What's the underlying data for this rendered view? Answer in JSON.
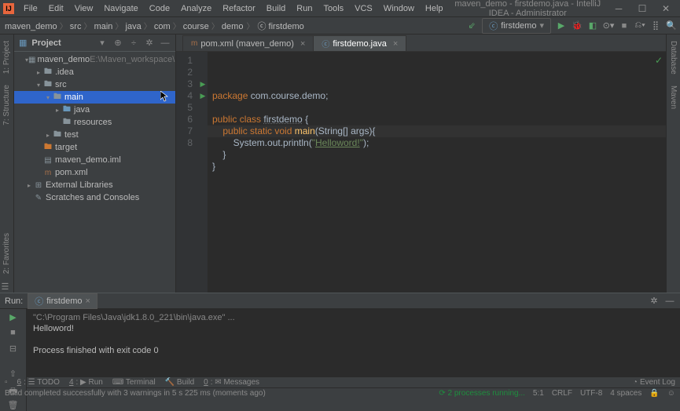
{
  "window": {
    "title": "maven_demo - firstdemo.java - IntelliJ IDEA - Administrator"
  },
  "menubar": [
    "File",
    "Edit",
    "View",
    "Navigate",
    "Code",
    "Analyze",
    "Refactor",
    "Build",
    "Run",
    "Tools",
    "VCS",
    "Window",
    "Help"
  ],
  "breadcrumb": [
    "maven_demo",
    "src",
    "main",
    "java",
    "com",
    "course",
    "demo",
    "firstdemo"
  ],
  "run_config": {
    "selected": "firstdemo"
  },
  "project_panel": {
    "title": "Project",
    "root": {
      "name": "maven_demo",
      "path": "E:\\Maven_workspace\\maven_demo"
    },
    "nodes": [
      {
        "lvl": 1,
        "exp": true,
        "icon": "module",
        "label": "maven_demo",
        "dim": "E:\\Maven_workspace\\maven_demo"
      },
      {
        "lvl": 2,
        "exp": false,
        "icon": "folder",
        "label": ".idea"
      },
      {
        "lvl": 2,
        "exp": true,
        "icon": "folder",
        "label": "src"
      },
      {
        "lvl": 3,
        "exp": true,
        "icon": "folder",
        "label": "main",
        "sel": true
      },
      {
        "lvl": 4,
        "exp": false,
        "icon": "blue",
        "label": "java"
      },
      {
        "lvl": 4,
        "exp": null,
        "icon": "folder",
        "label": "resources"
      },
      {
        "lvl": 3,
        "exp": false,
        "icon": "folder",
        "label": "test"
      },
      {
        "lvl": 2,
        "exp": null,
        "icon": "orange",
        "label": "target"
      },
      {
        "lvl": 2,
        "exp": null,
        "icon": "file",
        "label": "maven_demo.iml"
      },
      {
        "lvl": 2,
        "exp": null,
        "icon": "xml",
        "label": "pom.xml"
      },
      {
        "lvl": 1,
        "exp": false,
        "icon": "lib",
        "label": "External Libraries"
      },
      {
        "lvl": 1,
        "exp": null,
        "icon": "scratch",
        "label": "Scratches and Consoles"
      }
    ]
  },
  "editor": {
    "tabs": [
      {
        "label": "pom.xml (maven_demo)",
        "active": false,
        "icon": "xml"
      },
      {
        "label": "firstdemo.java",
        "active": true,
        "icon": "class"
      }
    ],
    "lines": [
      {
        "n": 1,
        "code": {
          "pkg": "package ",
          "path": "com.course.demo",
          "semi": ";"
        }
      },
      {
        "n": 2,
        "code": {}
      },
      {
        "n": 3,
        "run": true,
        "code": {
          "k1": "public class ",
          "cls": "firstdemo",
          "b": " {"
        }
      },
      {
        "n": 4,
        "run": true,
        "code": {
          "pad": "    ",
          "k2": "public static void ",
          "m": "main",
          "sig": "(String[] args){"
        }
      },
      {
        "n": 5,
        "code": {
          "pad": "        ",
          "stmt": "System.out.println(",
          "q": "\"",
          "str": "Helloword!",
          "q2": "\"",
          "end": ");"
        }
      },
      {
        "n": 6,
        "code": {
          "pad": "    ",
          "b": "}"
        }
      },
      {
        "n": 7,
        "caret": true,
        "code": {
          "b": "}"
        }
      },
      {
        "n": 8,
        "code": {}
      }
    ]
  },
  "run": {
    "label": "Run:",
    "tab": "firstdemo",
    "output": [
      {
        "cls": "cmd",
        "text": "\"C:\\Program Files\\Java\\jdk1.8.0_221\\bin\\java.exe\" ..."
      },
      {
        "cls": "txt",
        "text": "Helloword!"
      },
      {
        "cls": "txt",
        "text": ""
      },
      {
        "cls": "txt",
        "text": "Process finished with exit code 0"
      }
    ]
  },
  "toolstrip": {
    "items": [
      {
        "icon": "☰",
        "label": "TODO",
        "num": "6:"
      },
      {
        "icon": "▶",
        "label": "Run",
        "num": "4:"
      },
      {
        "icon": "⌨",
        "label": "Terminal"
      },
      {
        "icon": "🔨",
        "label": "Build"
      },
      {
        "icon": "✉",
        "label": "Messages",
        "num": "0:"
      }
    ],
    "event_log": "Event Log"
  },
  "status": {
    "msg": "Build completed successfully with 3 warnings in 5 s 225 ms (moments ago)",
    "proc": "2 processes running...",
    "pos": "5:1",
    "lf": "CRLF",
    "enc": "UTF-8",
    "indent": "4 spaces"
  },
  "left_gutter": [
    "1: Project",
    "7: Structure",
    "2: Favorites"
  ],
  "right_gutter": [
    "Database",
    "Maven"
  ]
}
